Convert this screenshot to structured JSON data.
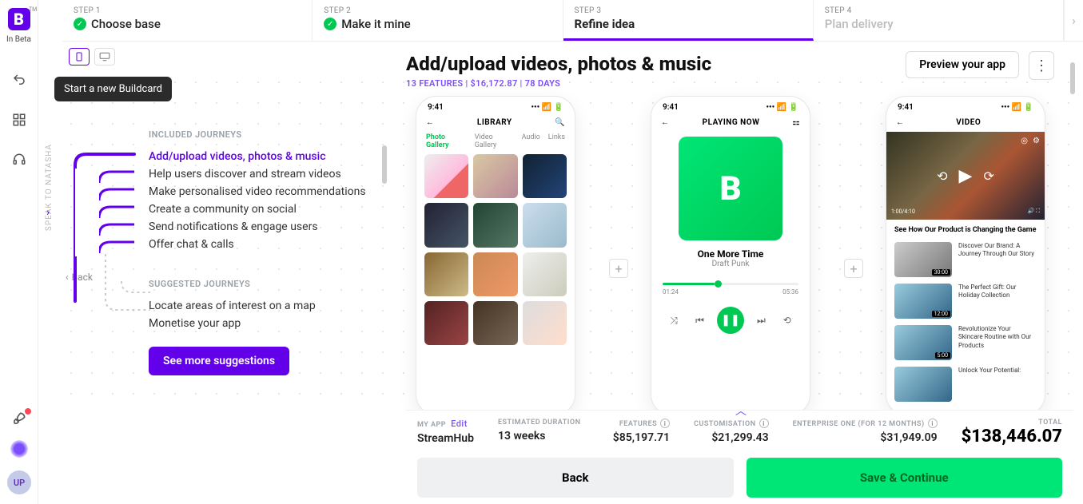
{
  "branding": {
    "logo_letter": "B",
    "tm": "TM",
    "in_beta": "In Beta"
  },
  "tooltip": "Start a new Buildcard",
  "avatar_initials": "UP",
  "speak_label": "SPEAK TO NATASHA",
  "steps": [
    {
      "num": "STEP 1",
      "label": "Choose base",
      "done": true
    },
    {
      "num": "STEP 2",
      "label": "Make it mine",
      "done": true
    },
    {
      "num": "STEP 3",
      "label": "Refine idea",
      "active": true
    },
    {
      "num": "STEP 4",
      "label": "Plan delivery",
      "future": true
    }
  ],
  "back_label": "Back",
  "included_title": "INCLUDED JOURNEYS",
  "included_journeys": [
    "Add/upload videos, photos & music",
    "Help users discover and stream videos",
    "Make personalised video recommendations",
    "Create a community on social",
    "Send notifications & engage users",
    "Offer chat & calls"
  ],
  "suggested_title": "SUGGESTED JOURNEYS",
  "suggested_journeys": [
    "Locate areas of interest on a map",
    "Monetise your app"
  ],
  "see_more": "See more suggestions",
  "main": {
    "title": "Add/upload videos, photos & music",
    "sub": "13 FEATURES | $16,172.87 | 78 DAYS",
    "preview": "Preview your app"
  },
  "phone_library": {
    "time": "9:41",
    "title": "LIBRARY",
    "tabs": [
      "Photo Gallery",
      "Video Gallery",
      "Audio",
      "Links"
    ]
  },
  "phone_player": {
    "time": "9:41",
    "title": "PLAYING NOW",
    "song": "One More Time",
    "artist": "Draft Punk",
    "elapsed": "01:24",
    "total": "05:36"
  },
  "phone_video": {
    "time": "9:41",
    "title": "VIDEO",
    "hero_seek": "1:00/4:10",
    "headline": "See How Our Product is Changing the Game",
    "items": [
      {
        "title": "Discover Our Brand: A Journey Through Our Story",
        "dur": "30:00"
      },
      {
        "title": "The Perfect Gift: Our Holiday Collection",
        "dur": "12:00"
      },
      {
        "title": "Revolutionize Your Skincare Routine with Our Products",
        "dur": "5:00"
      },
      {
        "title": "Unlock Your Potential:",
        "dur": ""
      }
    ]
  },
  "footer": {
    "my_app_label": "MY APP",
    "edit": "Edit",
    "my_app": "StreamHub",
    "duration_label": "ESTIMATED DURATION",
    "duration": "13 weeks",
    "features_label": "FEATURES",
    "features": "$85,197.71",
    "custom_label": "CUSTOMISATION",
    "custom": "$21,299.43",
    "enterprise_label": "ENTERPRISE ONE (FOR 12 MONTHS)",
    "enterprise": "$31,949.09",
    "total_label": "TOTAL",
    "total": "$138,446.07",
    "back_btn": "Back",
    "save_btn": "Save & Continue"
  }
}
